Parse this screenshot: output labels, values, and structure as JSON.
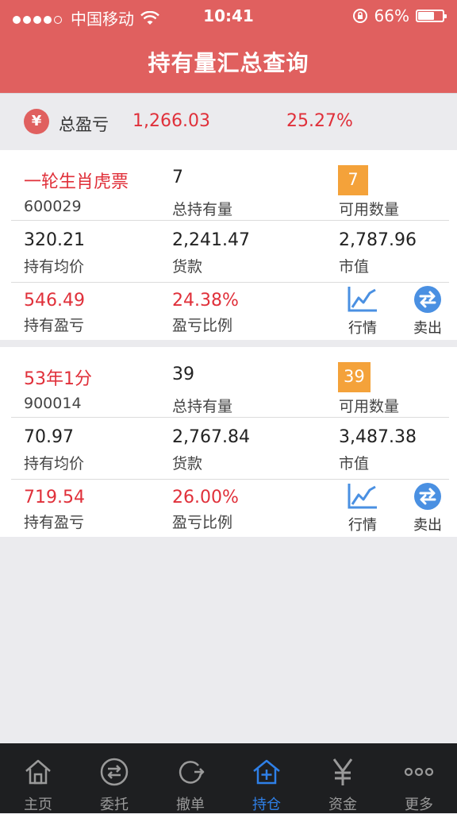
{
  "status_bar": {
    "carrier": "中国移动",
    "time": "10:41",
    "battery": "66%"
  },
  "header": {
    "title": "持有量汇总查询"
  },
  "summary": {
    "label": "总盈亏",
    "profit_loss": "1,266.03",
    "ratio": "25.27%"
  },
  "labels": {
    "total_holding": "总持有量",
    "available": "可用数量",
    "avg_price": "持有均价",
    "payment": "货款",
    "market_value": "市值",
    "holding_pl": "持有盈亏",
    "pl_ratio": "盈亏比例",
    "quote": "行情",
    "sell": "卖出"
  },
  "holdings": [
    {
      "name": "一轮生肖虎票",
      "code": "600029",
      "total": "7",
      "available": "7",
      "avg_price": "320.21",
      "payment": "2,241.47",
      "market_value": "2,787.96",
      "holding_pl": "546.49",
      "pl_ratio": "24.38%"
    },
    {
      "name": "53年1分",
      "code": "900014",
      "total": "39",
      "available": "39",
      "avg_price": "70.97",
      "payment": "2,767.84",
      "market_value": "3,487.38",
      "holding_pl": "719.54",
      "pl_ratio": "26.00%"
    }
  ],
  "tabs": [
    {
      "label": "主页",
      "icon": "home-icon"
    },
    {
      "label": "委托",
      "icon": "exchange-icon"
    },
    {
      "label": "撤单",
      "icon": "undo-icon"
    },
    {
      "label": "持仓",
      "icon": "holding-icon",
      "active": true
    },
    {
      "label": "资金",
      "icon": "yen-icon"
    },
    {
      "label": "更多",
      "icon": "more-icon"
    }
  ],
  "colors": {
    "header": "#e0605f",
    "loss_profit": "#e0303a",
    "badge": "#f4a23a",
    "tab_active": "#2f80e8",
    "icon_blue": "#4a90e2"
  }
}
